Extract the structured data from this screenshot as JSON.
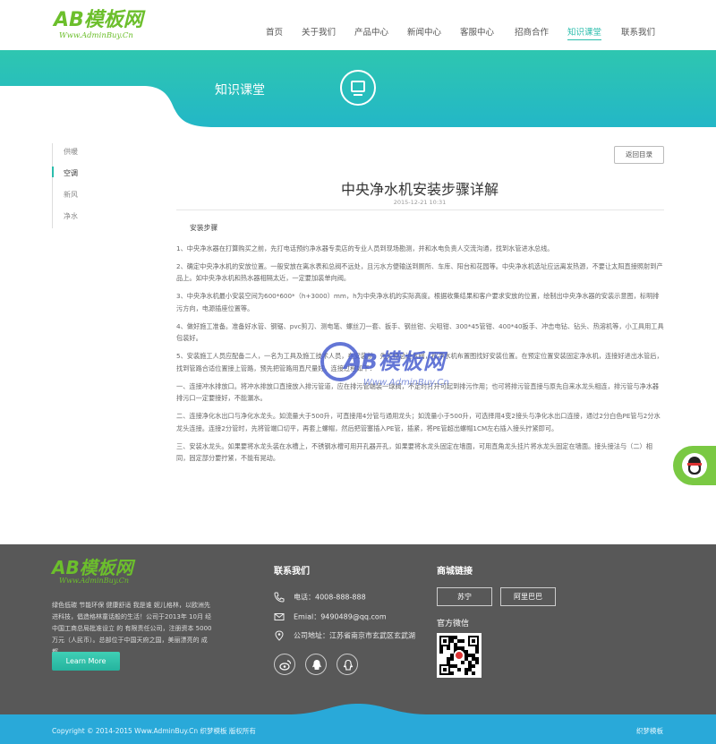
{
  "header": {
    "logo_mark": "AB模板网",
    "logo_url": "Www.AdminBuy.Cn",
    "nav": [
      "首页",
      "关于我们",
      "产品中心",
      "新闻中心",
      "客服中心",
      "招商合作",
      "知识课堂",
      "联系我们"
    ],
    "active_nav": "知识课堂"
  },
  "banner": {
    "title": "知识课堂",
    "icon": "monitor-icon",
    "color_top": "#2bbdac",
    "color_main": "#2ec6b0"
  },
  "sidebar": {
    "items": [
      "供暖",
      "空调",
      "新风",
      "净水"
    ],
    "active": "空调"
  },
  "article": {
    "back_label": "返回目录",
    "title": "中央净水机安装步骤详解",
    "date": "2015-12-21 10:31",
    "lead": "安装步骤",
    "paragraphs": [
      "1、中央净水器在打算购买之前，先打电话预约净水器专卖店的专业人员到现场勘测，并和水电负责人交流沟通，找到水管进水总线。",
      "2、确定中央净水机的安放位置。一般安放在离水表和总阀不远处，且污水方便输送到厕所、车库、阳台和花园等。中央净水机选址应远离发热源，不要让太阳直接照射到产品上。如中央净水机和热水器相隔太近，一定要加装单向阀。",
      "3、中央净水机最小安装空间为600*600*（h+3000）mm，h为中央净水机的实际高度。根据收集结果和客户要求安放的位置，绘制出中央净水器的安装示意图，标明排污方向，电源插座位置等。",
      "4、做好施工准备。准备好水管、钢锯、pvc剪刀、测电笔、螺丝刀一套、扳手、钢丝钳、尖咀钳、300*45管钳、400*40扳手、冲击电钻、钻头、热溶机等，小工具用工具包装好。",
      "5、安装施工人员应配备二人，一名为工具及施工技术人员，在安装前，先关掉总进水阀，按净水机布置图找好安装位置。在预定位置安装固定净水机，连接好进出水管后，找到管路合适位置接上管路，预先把管路用直尺量好，连接过程如下：",
      "一、连接冲水排放口。将冲水排放口直接放入排污管道，应在排污管端装一球阀，不定时打开可起到排污作用；也可将排污管直接与原先自来水龙头相连，排污管与净水器排污口一定要接好，不能漏水。",
      "二、连接净化水出口与净化水龙头。如流量大于500升，可直接用4分管与通用龙头；如流量小于500升，可选择用4变2接头与净化水出口连接，通过2分白色PE管与2分水龙头连接。连接2分管时，先将管端口切平，再套上螺帽，然后把管塞插入PE管，插紧，将PE管超出螺帽1CM左右插入接头拧紧即可。",
      "三、安装水龙头。如果要将水龙头装在水槽上，不锈钢水槽可用开孔器开孔，如果要将水龙头固定在墙面，可用直角龙头挂片将水龙头固定在墙面。接头接法与（二）相同，固定部分要拧紧，不能有晃动。"
    ]
  },
  "watermark": {
    "mark": "AB模板网",
    "url": "Www.AdminBuy.Cn"
  },
  "qq_float": {
    "icon": "qq-penguin-icon"
  },
  "footer": {
    "logo_mark": "AB模板网",
    "logo_url": "Www.AdminBuy.Cn",
    "desc": "绿色低碳 节能环保 健康舒适 我是谁 妮儿格林，以欧洲先进科技，倡造格林童话般的生活！公司于2013年 10月 经中国工商总局批准设立 的 有限责任公司，注册资本 5000万元（人民币）。总部位于中国天府之国，美丽漂亮的 成都...",
    "learn_more": "Learn More",
    "contact_heading": "联系我们",
    "phone": "电话：4008-888-888",
    "email": "Emial：9490489@qq.com",
    "address": "公司地址：江苏省南京市玄武区玄武湖",
    "links_heading": "商城链接",
    "links": [
      "苏宁",
      "阿里巴巴"
    ],
    "wechat_heading": "官方微信",
    "copyright": "Copyright © 2014-2015 Www.AdminBuy.Cn 织梦模板 版权所有",
    "copyright_right": "织梦模板",
    "footer_blue": "#29a9d9"
  }
}
